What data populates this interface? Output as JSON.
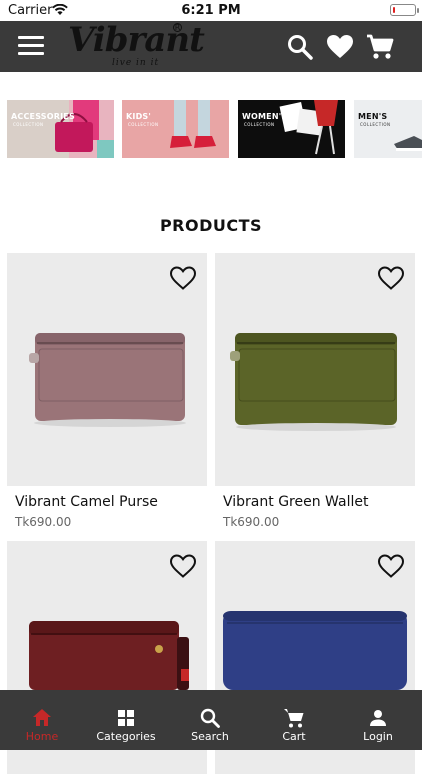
{
  "status_bar": {
    "carrier": "Carrier",
    "time": "6:21 PM",
    "battery_level": 0.12
  },
  "header": {
    "logo_text": "Vibrant",
    "logo_tagline": "live in it",
    "logo_reg": "R",
    "icons": [
      "menu-icon",
      "search-icon",
      "heart-icon",
      "cart-icon"
    ]
  },
  "collections": [
    {
      "title": "ACCESSORIES",
      "subtitle": "COLLECTION"
    },
    {
      "title": "KIDS'",
      "subtitle": "COLLECTION"
    },
    {
      "title": "WOMEN'S",
      "subtitle": "COLLECTION"
    },
    {
      "title": "MEN'S",
      "subtitle": "COLLECTION"
    }
  ],
  "section_title": "PRODUCTS",
  "products": [
    {
      "name": "Vibrant Camel Purse",
      "price": "Tk690.00",
      "color": "#9a7478"
    },
    {
      "name": "Vibrant Green Wallet",
      "price": "Tk690.00",
      "color": "#5b6428"
    },
    {
      "name": "",
      "price": "",
      "color": "#6e1f22"
    },
    {
      "name": "",
      "price": "",
      "color": "#2f3f86"
    }
  ],
  "bottom_nav": {
    "items": [
      {
        "label": "Home",
        "icon": "home-icon",
        "active": true
      },
      {
        "label": "Categories",
        "icon": "categories-icon",
        "active": false
      },
      {
        "label": "Search",
        "icon": "search-icon",
        "active": false
      },
      {
        "label": "Cart",
        "icon": "cart-icon",
        "active": false
      },
      {
        "label": "Login",
        "icon": "user-icon",
        "active": false
      }
    ]
  },
  "colors": {
    "header_bg": "#3a3a3a",
    "accent": "#c62828",
    "card_bg": "#ebebeb"
  }
}
